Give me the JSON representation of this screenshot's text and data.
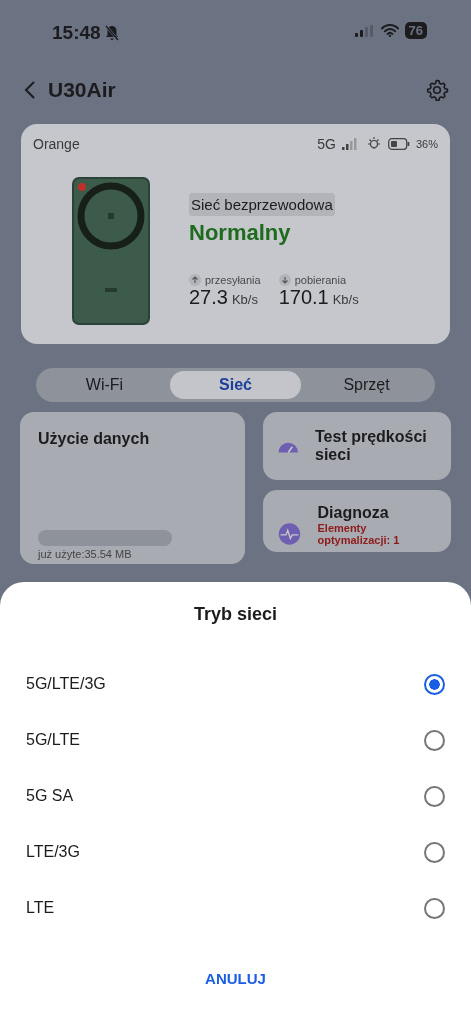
{
  "status_bar": {
    "time": "15:48",
    "battery": "76"
  },
  "header": {
    "title": "U30Air"
  },
  "device_card": {
    "operator": "Orange",
    "network_type": "5G",
    "battery": "36%",
    "connection_label": "Sieć bezprzewodowa",
    "status": "Normalny",
    "upload": {
      "label": "przesyłania",
      "value": "27.3",
      "unit": "Kb/s"
    },
    "download": {
      "label": "pobierania",
      "value": "170.1",
      "unit": "Kb/s"
    }
  },
  "tabs": [
    {
      "label": "Wi-Fi",
      "selected": false
    },
    {
      "label": "Sieć",
      "selected": true
    },
    {
      "label": "Sprzęt",
      "selected": false
    }
  ],
  "data_usage": {
    "title": "Użycie danych",
    "used": "już użyte:35.54 MB"
  },
  "speed_test": {
    "title": "Test prędkości sieci"
  },
  "diagnosis": {
    "title": "Diagnoza",
    "note": "Elementy optymalizacji: 1"
  },
  "sheet": {
    "title": "Tryb sieci",
    "options": [
      {
        "label": "5G/LTE/3G",
        "selected": true
      },
      {
        "label": "5G/LTE",
        "selected": false
      },
      {
        "label": "5G SA",
        "selected": false
      },
      {
        "label": "LTE/3G",
        "selected": false
      },
      {
        "label": "LTE",
        "selected": false
      }
    ],
    "cancel": "ANULUJ"
  }
}
